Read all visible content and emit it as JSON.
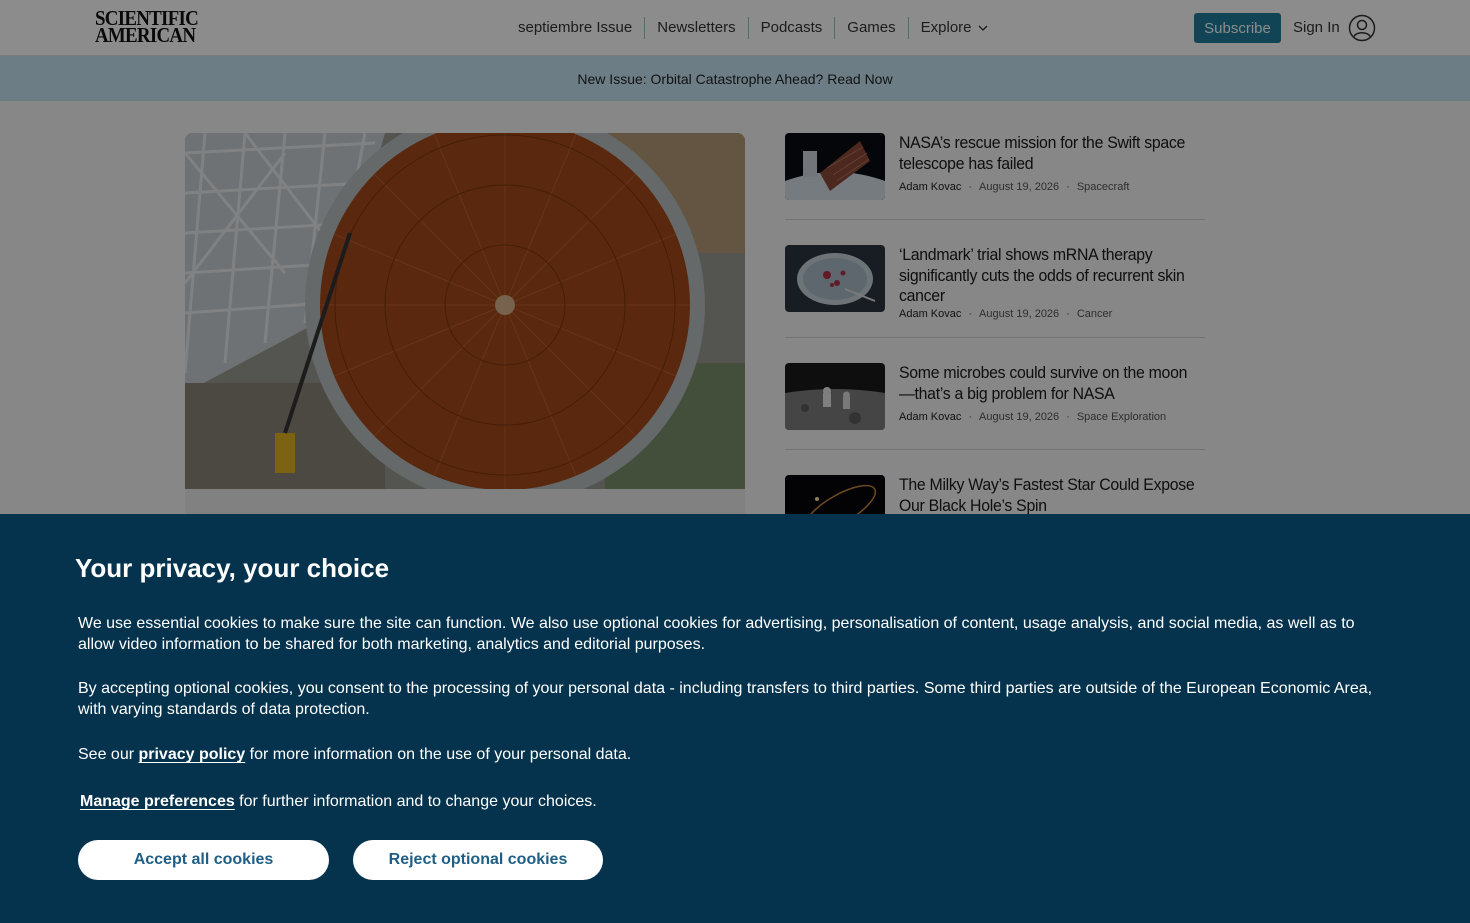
{
  "header": {
    "logo_line1": "SCIENTIFIC",
    "logo_line2": "AMERICAN",
    "nav": [
      "septiembre Issue",
      "Newsletters",
      "Podcasts",
      "Games",
      "Explore"
    ],
    "subscribe": "Subscribe",
    "sign_in": "Sign In"
  },
  "banner": {
    "text": "New Issue: Orbital Catastrophe Ahead? Read Now"
  },
  "articles": [
    {
      "title": "NASA’s rescue mission for the Swift space telescope has failed",
      "author": "Adam Kovac",
      "date": "August 19, 2026",
      "category": "Spacecraft",
      "thumb_icon": "satellite-thumbnail"
    },
    {
      "title": "‘Landmark’ trial shows mRNA therapy significantly cuts the odds of recurrent skin cancer",
      "author": "Adam Kovac",
      "date": "August 19, 2026",
      "category": "Cancer",
      "thumb_icon": "petri-dish-thumbnail"
    },
    {
      "title": "Some microbes could survive on the moon—that’s a big problem for NASA",
      "author": "Adam Kovac",
      "date": "August 19, 2026",
      "category": "Space Exploration",
      "thumb_icon": "moon-astronaut-thumbnail"
    },
    {
      "title": "The Milky Way’s Fastest Star Could Expose Our Black Hole’s Spin",
      "thumb_icon": "black-hole-orbit-thumbnail"
    }
  ],
  "cookie": {
    "title": "Your privacy, your choice",
    "p1": "We use essential cookies to make sure the site can function. We also use optional cookies for advertising, personalisation of content, usage analysis, and social media, as well as to allow video information to be shared for both marketing, analytics and editorial purposes.",
    "p2": "By accepting optional cookies, you consent to the processing of your personal data - including transfers to third parties. Some third parties are outside of the European Economic Area, with varying standards of data protection.",
    "p3_pre": "See our ",
    "p3_link": "privacy policy",
    "p3_post": " for more information on the use of your personal data.",
    "p4_link": "Manage preferences",
    "p4_post": " for further information and to change your choices.",
    "accept": "Accept all cookies",
    "reject": "Reject optional cookies"
  },
  "colors": {
    "subscribe_bg": "#1f7d9a",
    "banner_bg": "#c7e4f2",
    "cookie_bg": "#05334d",
    "button_text": "#1f5f85"
  }
}
